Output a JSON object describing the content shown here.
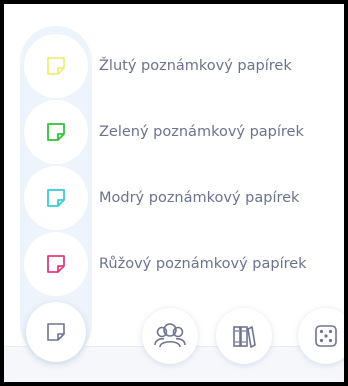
{
  "notes": [
    {
      "label": "Žlutý poznámkový papírek",
      "color": "#f3ec7a",
      "icon": "yellow-sticky-note-icon"
    },
    {
      "label": "Zelený poznámkový papírek",
      "color": "#2ec535",
      "icon": "green-sticky-note-icon"
    },
    {
      "label": "Modrý poznámkový papírek",
      "color": "#38ccd6",
      "icon": "blue-sticky-note-icon"
    },
    {
      "label": "Růžový poznámkový papírek",
      "color": "#e23b7d",
      "icon": "pink-sticky-note-icon"
    }
  ],
  "toolbar": {
    "active_tool_icon": "sticky-note-icon",
    "buttons": [
      "people-icon",
      "books-icon",
      "dice-icon"
    ],
    "icon_color": "#6e7591",
    "accent": "#eef4fb"
  }
}
